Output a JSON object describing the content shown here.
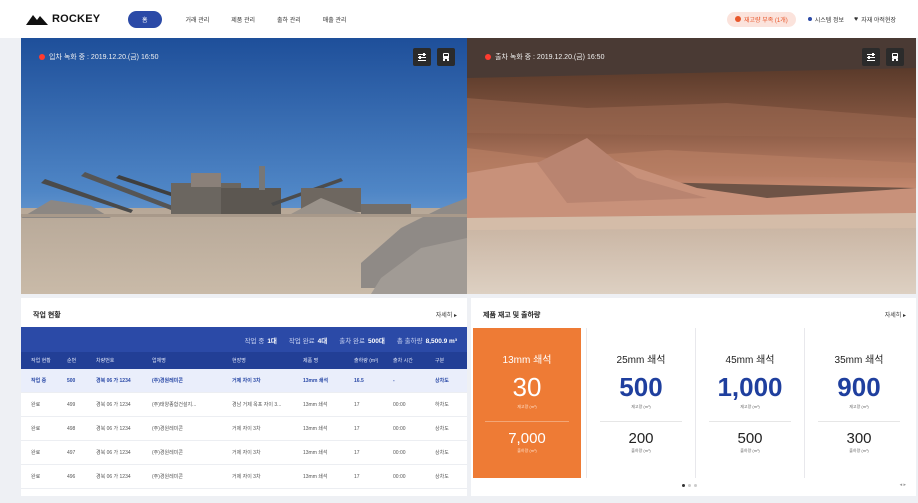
{
  "header": {
    "logo_text": "ROCKEY",
    "nav": [
      "홈",
      "거래 관리",
      "제품 관리",
      "출하 관리",
      "매출 관리"
    ],
    "alert": "재고량 부족 (1개)",
    "tools": [
      "시스템 정보",
      "자재 야적현장"
    ]
  },
  "cameras": [
    {
      "label": "입차 녹화 중 : 2019.12.20.(금) 16:50"
    },
    {
      "label": "출차 녹화 중 : 2019.12.20.(금) 16:50"
    }
  ],
  "work": {
    "title": "작업 현황",
    "more": "자세히 ▸",
    "summary": [
      {
        "label": "작업 중",
        "value": "1대"
      },
      {
        "label": "작업 완료",
        "value": "4대"
      },
      {
        "label": "출차 완료",
        "value": "500대"
      },
      {
        "label": "총 출하량",
        "value": "8,500.9 m³"
      }
    ],
    "columns": [
      "작업 현황",
      "순번",
      "차량번호",
      "업체명",
      "현장명",
      "제품 명",
      "출하량 (m³)",
      "출차 시간",
      "구분"
    ],
    "rows": [
      [
        "작업 중",
        "500",
        "경북 06 가 1234",
        "(주)경원레미콘",
        "거제 자이 3차",
        "13mm 쇄석",
        "16.5",
        "-",
        "상차도"
      ],
      [
        "완료",
        "499",
        "경북 06 가 1234",
        "(주)태양종합건설지...",
        "경남 거제 옥포 자이 3...",
        "13mm 쇄석",
        "17",
        "00:00",
        "하차도"
      ],
      [
        "완료",
        "498",
        "경북 06 가 1234",
        "(주)경원레미콘",
        "거제 자이 3차",
        "13mm 쇄석",
        "17",
        "00:00",
        "상차도"
      ],
      [
        "완료",
        "497",
        "경북 06 가 1234",
        "(주)경원레미콘",
        "거제 자이 3차",
        "13mm 쇄석",
        "17",
        "00:00",
        "상차도"
      ],
      [
        "완료",
        "496",
        "경북 06 가 1234",
        "(주)경원레미콘",
        "거제 자이 3차",
        "13mm 쇄석",
        "17",
        "00:00",
        "상차도"
      ]
    ]
  },
  "stock": {
    "title": "제품 재고 및 출하량",
    "more": "자세히 ▸",
    "stock_label": "재고량 (m³)",
    "ship_label": "출하량 (m³)",
    "products": [
      {
        "name": "13mm 쇄석",
        "stock": "30",
        "shipped": "7,000"
      },
      {
        "name": "25mm 쇄석",
        "stock": "500",
        "shipped": "200"
      },
      {
        "name": "45mm 쇄석",
        "stock": "1,000",
        "shipped": "500"
      },
      {
        "name": "35mm 쇄석",
        "stock": "900",
        "shipped": "300"
      }
    ],
    "arrows": "◂ ▸"
  },
  "colors": {
    "primary": "#2b4aa7",
    "accent": "#ee7b35",
    "alert": "#e8562a"
  }
}
